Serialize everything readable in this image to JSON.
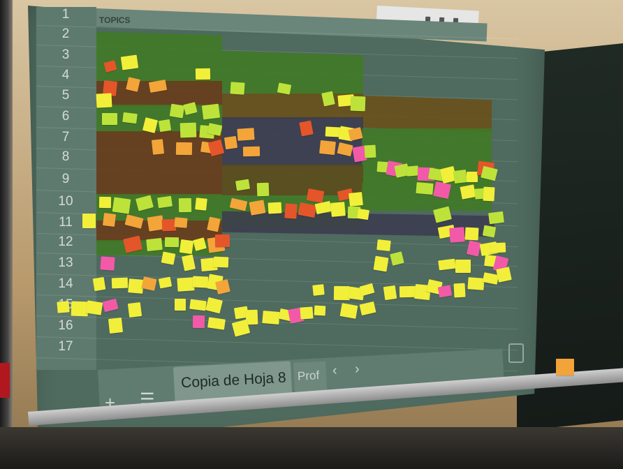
{
  "spreadsheet": {
    "row_numbers": [
      "1",
      "2",
      "3",
      "4",
      "5",
      "6",
      "7",
      "8",
      "9",
      "10",
      "11",
      "12",
      "13",
      "14",
      "15",
      "16",
      "17"
    ],
    "header_cell": "TOPICS",
    "sheet_tab": "Copia de Hoja 8",
    "second_tab": "Prof",
    "add_sheet_icon": "plus-icon",
    "sheets_menu_icon": "hamburger-menu-icon",
    "prev_icon": "chevron-left-icon",
    "next_icon": "chevron-right-icon"
  },
  "colors": {
    "green_band": "#3f7a23",
    "brown_band": "#6a3a16",
    "purple_band": "#3b3a4f",
    "olive_band": "#6b4f17",
    "sticky_yellow": "#f2ef3a",
    "sticky_lime": "#bde33a",
    "sticky_orange": "#f3a53a",
    "sticky_pink": "#f25aa8",
    "sticky_red": "#e5552a"
  }
}
